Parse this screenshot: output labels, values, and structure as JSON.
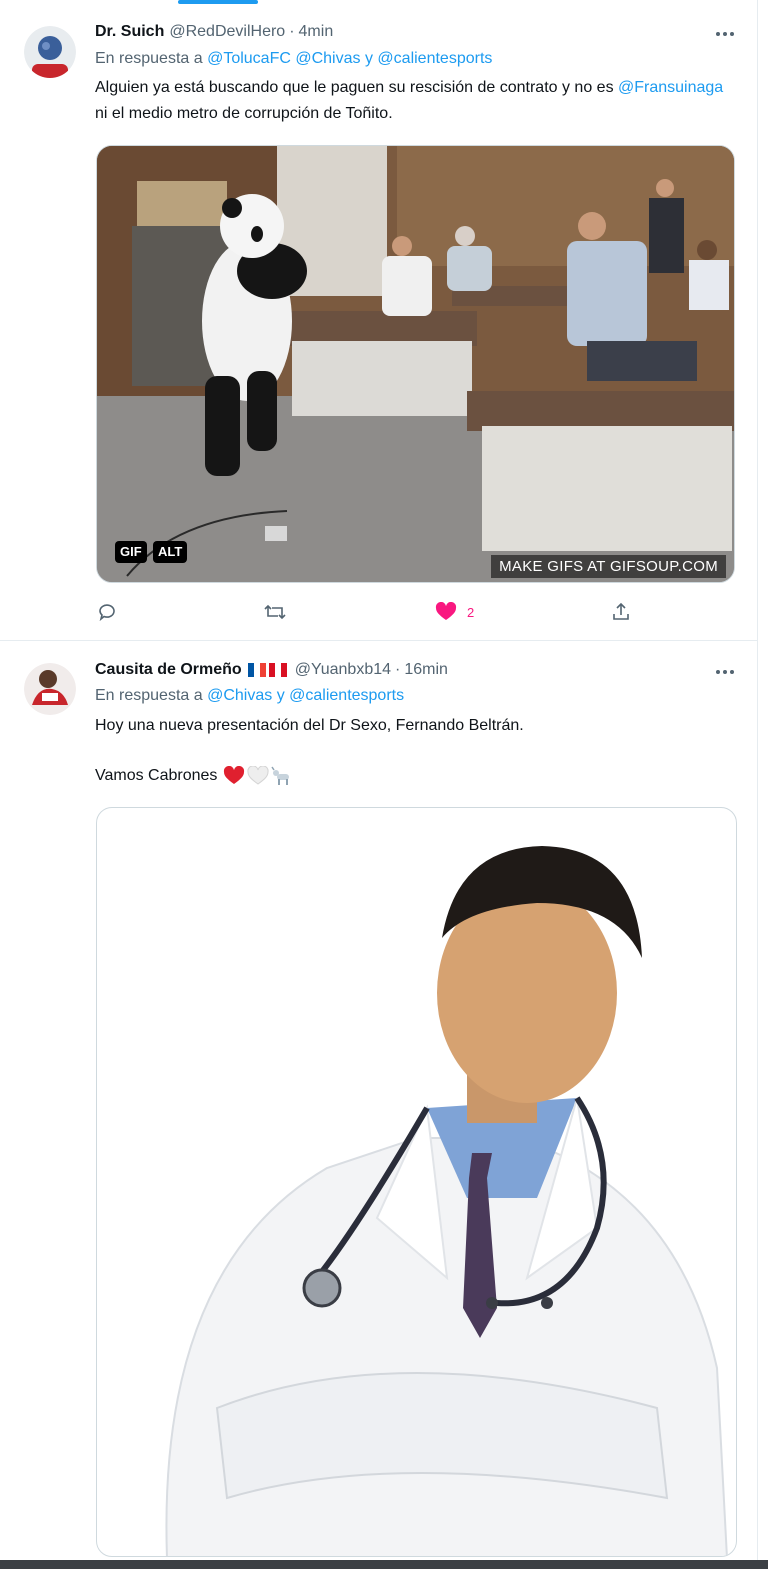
{
  "tweets": [
    {
      "name": "Dr. Suich",
      "handle": "@RedDevilHero",
      "time": "4min",
      "reply_prefix": "En respuesta a",
      "reply_mentions": [
        "@TolucaFC",
        "@Chivas",
        "@calientesports"
      ],
      "reply_joiner": "y",
      "text_part1": "Alguien ya está buscando que le paguen su rescisión de contrato y no es ",
      "text_mention": "@Fransuinaga",
      "text_part2": " ni el medio metro de corrupción de Toñito.",
      "media": {
        "type": "gif",
        "badge_gif": "GIF",
        "badge_alt": "ALT",
        "watermark": "MAKE GIFS AT GIFSOUP.COM"
      },
      "actions": {
        "reply_icon": "reply-icon",
        "retweet_icon": "retweet-icon",
        "like_icon": "heart-filled-icon",
        "like_count": "2",
        "share_icon": "share-icon"
      }
    },
    {
      "name": "Causita de Ormeño",
      "flags": [
        "France",
        "Peru"
      ],
      "handle": "@Yuanbxb14",
      "time": "16min",
      "reply_prefix": "En respuesta a",
      "reply_mentions": [
        "@Chivas",
        "@calientesports"
      ],
      "reply_joiner": "y",
      "text_line1": "Hoy una nueva presentación del Dr Sexo, Fernando Beltrán.",
      "text_line2": "Vamos Cabrones",
      "emojis": [
        "red-heart",
        "white-heart",
        "goat"
      ],
      "media": {
        "type": "photo",
        "subject": "doctor-photo"
      }
    }
  ],
  "colors": {
    "link": "#1d9bf0",
    "like": "#f91880",
    "secondary": "#536471"
  }
}
